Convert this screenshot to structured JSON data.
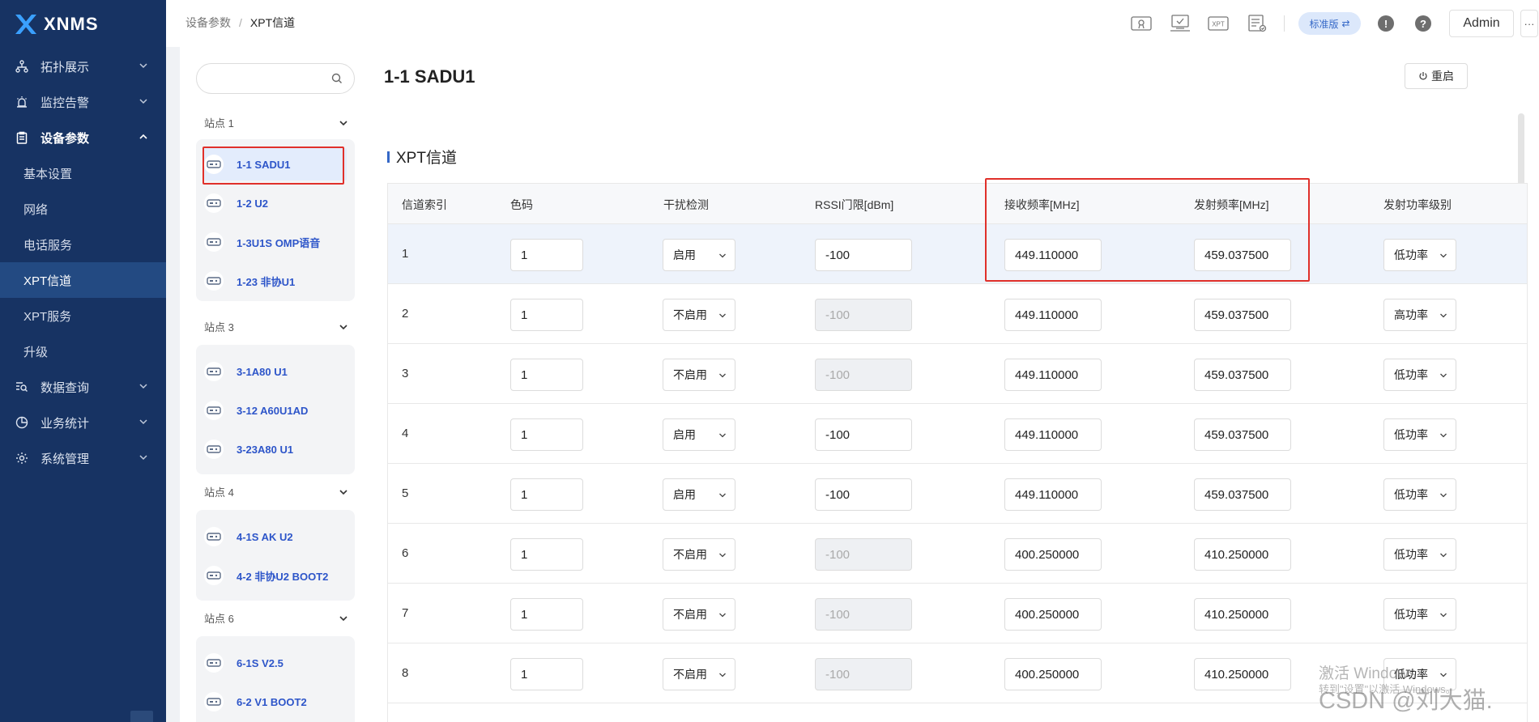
{
  "app": {
    "brand": "XNMS"
  },
  "nav": {
    "items": [
      {
        "label": "拓扑展示",
        "icon": "topology-icon"
      },
      {
        "label": "监控告警",
        "icon": "alarm-icon"
      },
      {
        "label": "设备参数",
        "icon": "clipboard-icon",
        "open": true
      },
      {
        "label": "数据查询",
        "icon": "data-query-icon"
      },
      {
        "label": "业务统计",
        "icon": "pie-chart-icon"
      },
      {
        "label": "系统管理",
        "icon": "gear-icon"
      }
    ],
    "subitems": [
      "基本设置",
      "网络",
      "电话服务",
      "XPT信道",
      "XPT服务",
      "升级"
    ],
    "active_sub": "XPT信道"
  },
  "breadcrumb": {
    "parent": "设备参数",
    "sep": "/",
    "current": "XPT信道"
  },
  "topbar": {
    "edition": "标准版",
    "user": "Admin",
    "more": "···",
    "xpt_icon_text": "XPT",
    "alert_glyph": "!",
    "help_glyph": "?"
  },
  "tree": {
    "search_placeholder": "",
    "groups": [
      {
        "name": "站点 1",
        "devices": [
          "1-1 SADU1",
          "1-2 U2",
          "1-3U1S OMP语音",
          "1-23 非协U1"
        ]
      },
      {
        "name": "站点 3",
        "devices": [
          "3-1A80 U1",
          "3-12 A60U1AD",
          "3-23A80 U1"
        ]
      },
      {
        "name": "站点 4",
        "devices": [
          "4-1S AK U2",
          "4-2 非协U2 BOOT2"
        ]
      },
      {
        "name": "站点 6",
        "devices": [
          "6-1S V2.5",
          "6-2 V1 BOOT2"
        ]
      }
    ],
    "selected": "1-1 SADU1"
  },
  "main": {
    "title": "1-1 SADU1",
    "restart_label": "重启",
    "section_title": "XPT信道",
    "columns": [
      "信道索引",
      "色码",
      "干扰检测",
      "RSSI门限[dBm]",
      "接收频率[MHz]",
      "发射频率[MHz]",
      "发射功率级别"
    ],
    "rows": [
      {
        "idx": "1",
        "cc": "1",
        "det": "启用",
        "rssi": "-100",
        "rx": "449.110000",
        "tx": "459.037500",
        "pwr": "低功率"
      },
      {
        "idx": "2",
        "cc": "1",
        "det": "不启用",
        "rssi": "-100",
        "rx": "449.110000",
        "tx": "459.037500",
        "pwr": "高功率"
      },
      {
        "idx": "3",
        "cc": "1",
        "det": "不启用",
        "rssi": "-100",
        "rx": "449.110000",
        "tx": "459.037500",
        "pwr": "低功率"
      },
      {
        "idx": "4",
        "cc": "1",
        "det": "启用",
        "rssi": "-100",
        "rx": "449.110000",
        "tx": "459.037500",
        "pwr": "低功率"
      },
      {
        "idx": "5",
        "cc": "1",
        "det": "启用",
        "rssi": "-100",
        "rx": "449.110000",
        "tx": "459.037500",
        "pwr": "低功率"
      },
      {
        "idx": "6",
        "cc": "1",
        "det": "不启用",
        "rssi": "-100",
        "rx": "400.250000",
        "tx": "410.250000",
        "pwr": "低功率"
      },
      {
        "idx": "7",
        "cc": "1",
        "det": "不启用",
        "rssi": "-100",
        "rx": "400.250000",
        "tx": "410.250000",
        "pwr": "低功率"
      },
      {
        "idx": "8",
        "cc": "1",
        "det": "不启用",
        "rssi": "-100",
        "rx": "400.250000",
        "tx": "410.250000",
        "pwr": "低功率"
      }
    ]
  },
  "watermark": {
    "line1": "激活 Windows",
    "line2": "转到\"设置\"以激活 Windows。",
    "line3": "CSDN @刘大猫."
  },
  "colors": {
    "sidebar": "#173363",
    "accent": "#3568c7",
    "highlight_border": "#e0302a"
  }
}
